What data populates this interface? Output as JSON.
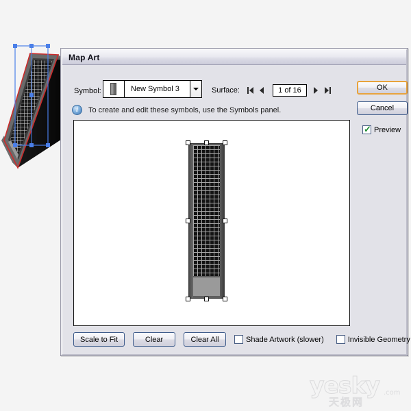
{
  "app": {
    "canvas_background": "#f4f4f4"
  },
  "artboard": {
    "object_name": "extruded-3d-symbol-artwork",
    "selection_color": "#4a7fe8",
    "path_outline_color": "#cc2b2b"
  },
  "dialog": {
    "title": "Map Art",
    "symbol": {
      "label": "Symbol:",
      "value": "New Symbol 3",
      "thumbnail_icon": "symbol-thumbnail",
      "dropdown_icon": "chevron-down-icon"
    },
    "surface": {
      "label": "Surface:",
      "value": "1 of 16",
      "current": 1,
      "total": 16,
      "first_icon": "first-page-icon",
      "prev_icon": "previous-page-icon",
      "next_icon": "next-page-icon",
      "last_icon": "last-page-icon"
    },
    "info": {
      "icon": "info-icon",
      "glyph": "i",
      "text": "To create and edit these symbols, use the Symbols panel."
    },
    "canvas": {
      "name": "artwork-preview-canvas",
      "background": "#ffffff"
    },
    "bottom_controls": {
      "scale_to_fit": "Scale to Fit",
      "clear": "Clear",
      "clear_all": "Clear All",
      "shade_artwork": {
        "label": "Shade Artwork (slower)",
        "checked": false
      },
      "invisible_geometry": {
        "label": "Invisible Geometry",
        "checked": false
      }
    },
    "actions": {
      "ok": "OK",
      "ok_focus_color": "#e8a33d",
      "cancel": "Cancel",
      "preview": {
        "label": "Preview",
        "checked": true,
        "check_glyph": "✓",
        "check_color": "#1a8a2e"
      }
    }
  },
  "watermark": {
    "main": "yesky",
    "suffix": ".com",
    "chinese": "天极网"
  }
}
